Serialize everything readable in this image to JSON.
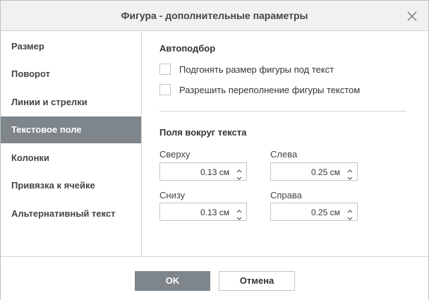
{
  "dialog": {
    "title": "Фигура - дополнительные параметры",
    "close_icon": "close-icon"
  },
  "sidebar": {
    "items": [
      {
        "label": "Размер"
      },
      {
        "label": "Поворот"
      },
      {
        "label": "Линии и стрелки"
      },
      {
        "label": "Текстовое поле",
        "active": true
      },
      {
        "label": "Колонки"
      },
      {
        "label": "Привязка к ячейке"
      },
      {
        "label": "Альтернативный текст"
      }
    ]
  },
  "autofit": {
    "title": "Автоподбор",
    "options": [
      {
        "label": "Подгонять размер фигуры под текст",
        "checked": false
      },
      {
        "label": "Разрешить переполнение фигуры текстом",
        "checked": false
      }
    ]
  },
  "margins": {
    "title": "Поля вокруг текста",
    "top": {
      "label": "Сверху",
      "value": "0.13 см"
    },
    "left": {
      "label": "Слева",
      "value": "0.25 см"
    },
    "bottom": {
      "label": "Снизу",
      "value": "0.13 см"
    },
    "right": {
      "label": "Справа",
      "value": "0.25 см"
    }
  },
  "footer": {
    "ok_label": "OK",
    "cancel_label": "Отмена"
  },
  "colors": {
    "active_bg": "#7e858b",
    "header_bg": "#f1f1f1",
    "border": "#c4c4c4"
  }
}
